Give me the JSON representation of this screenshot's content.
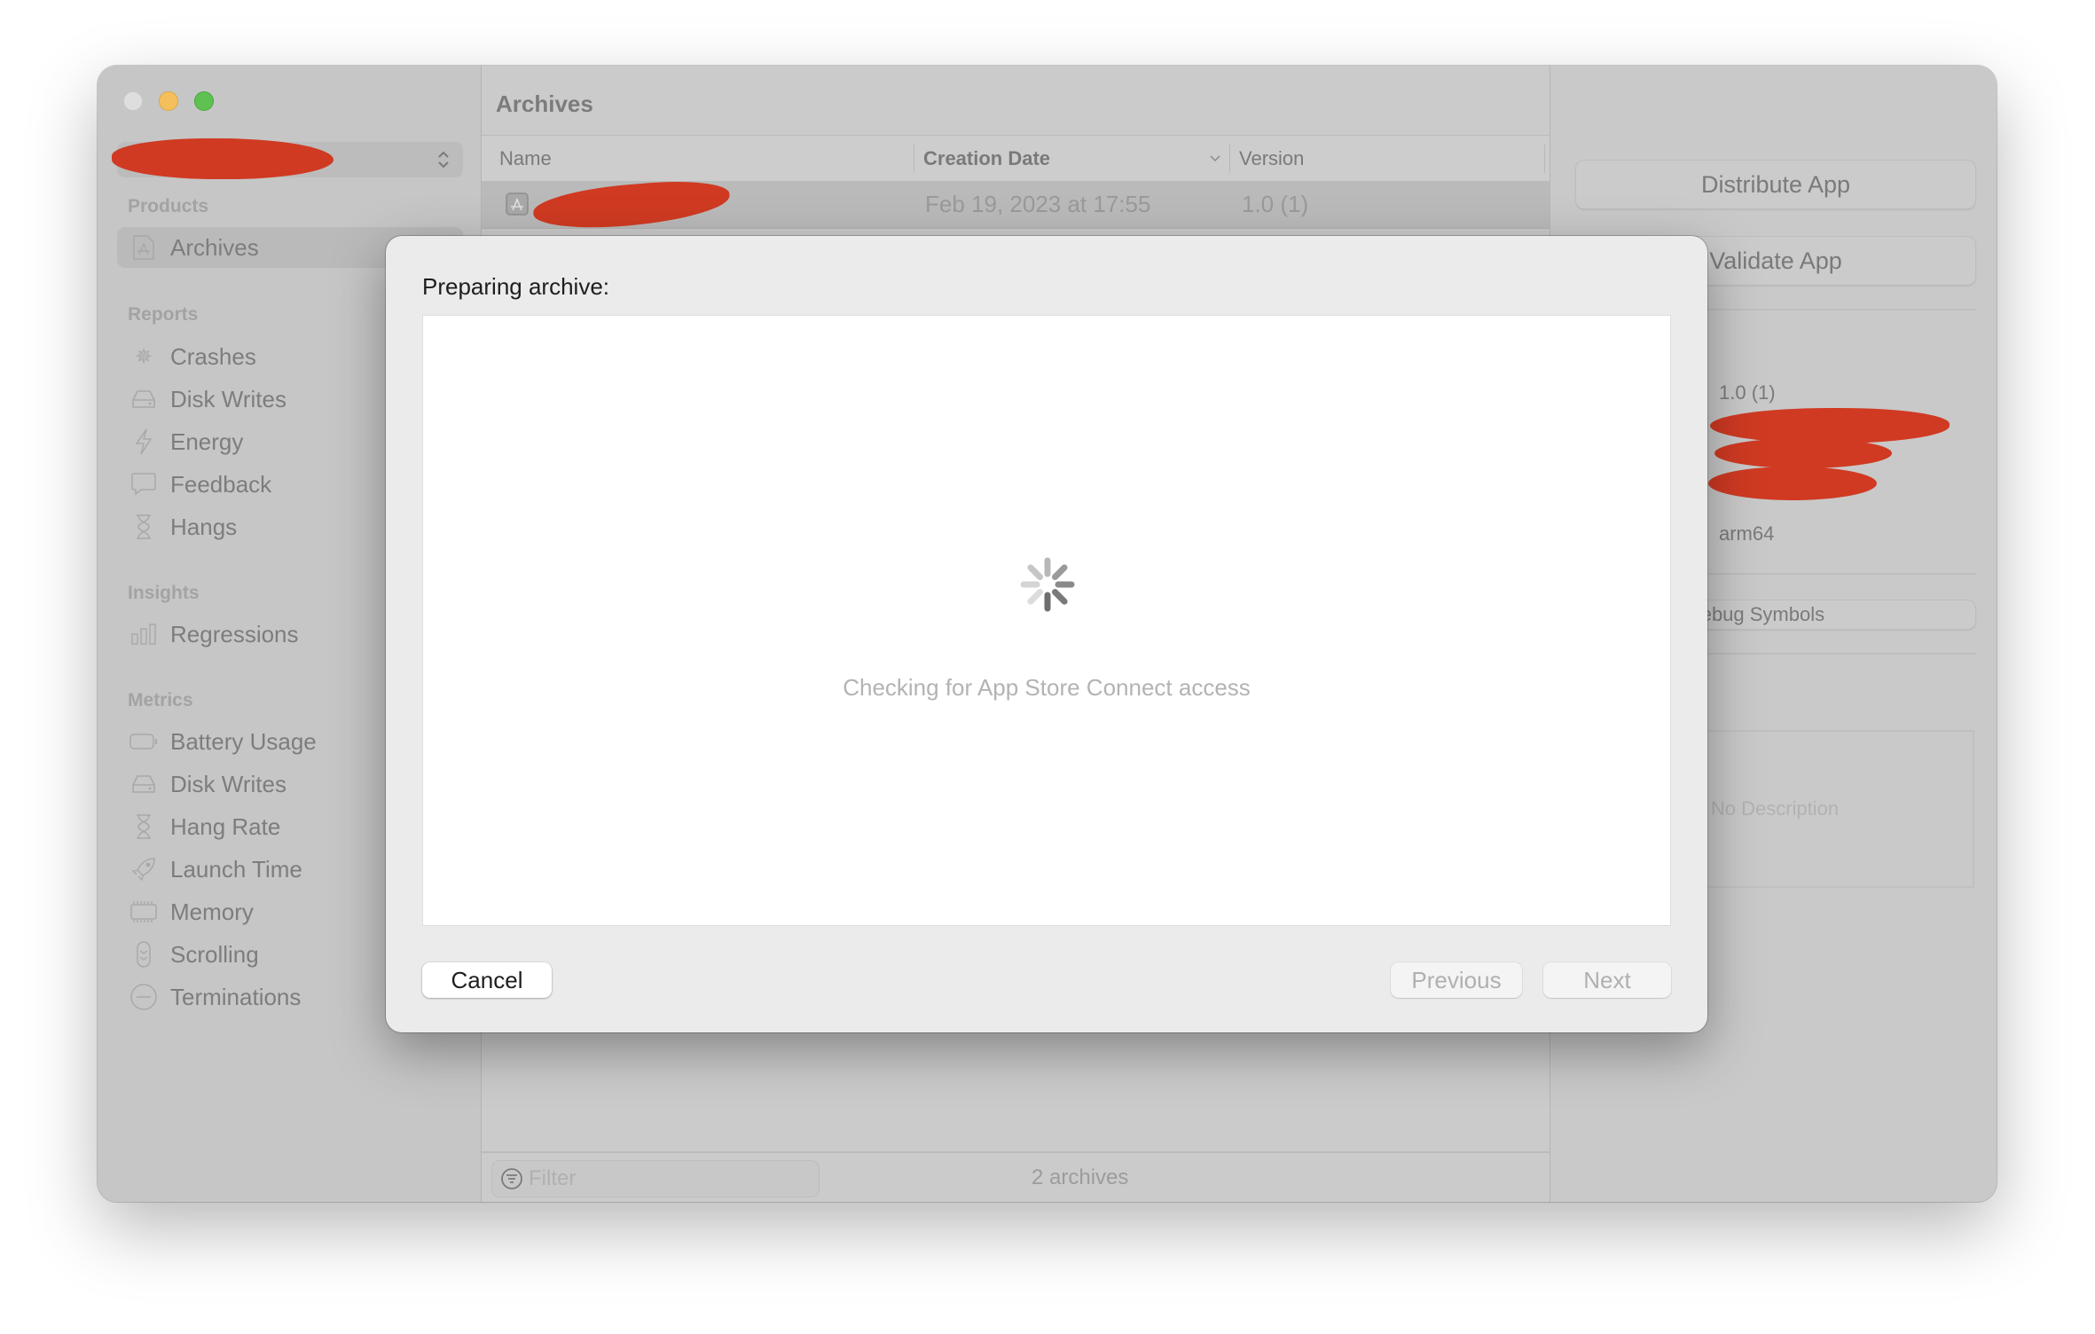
{
  "window": {
    "traffic_lights": {
      "close": "#dedede",
      "minimize": "#f5c05b",
      "zoom": "#5fc152"
    }
  },
  "sidebar": {
    "scheme_selector": {
      "value": "[redacted]",
      "chevron_icon": "up-down-chevron-icon"
    },
    "sections": [
      {
        "title": "Products",
        "items": [
          {
            "label": "Archives",
            "icon": "archive-app-icon",
            "selected": true
          }
        ]
      },
      {
        "title": "Reports",
        "items": [
          {
            "label": "Crashes",
            "icon": "crash-burst-icon"
          },
          {
            "label": "Disk Writes",
            "icon": "disk-drive-icon"
          },
          {
            "label": "Energy",
            "icon": "bolt-icon"
          },
          {
            "label": "Feedback",
            "icon": "speech-bubble-icon"
          },
          {
            "label": "Hangs",
            "icon": "hourglass-icon"
          }
        ]
      },
      {
        "title": "Insights",
        "items": [
          {
            "label": "Regressions",
            "icon": "bar-chart-icon"
          }
        ]
      },
      {
        "title": "Metrics",
        "items": [
          {
            "label": "Battery Usage",
            "icon": "battery-icon"
          },
          {
            "label": "Disk Writes",
            "icon": "disk-drive-icon"
          },
          {
            "label": "Hang Rate",
            "icon": "hourglass-icon"
          },
          {
            "label": "Launch Time",
            "icon": "rocket-icon"
          },
          {
            "label": "Memory",
            "icon": "memory-chip-icon"
          },
          {
            "label": "Scrolling",
            "icon": "scroll-icon"
          },
          {
            "label": "Terminations",
            "icon": "minus-circle-icon"
          }
        ]
      }
    ]
  },
  "archives": {
    "title": "Archives",
    "columns": [
      "Name",
      "Creation Date",
      "Version"
    ],
    "sort_column": "Creation Date",
    "rows": [
      {
        "name": "[redacted]",
        "creation_date": "Feb 19, 2023 at 17:55",
        "version": "1.0 (1)"
      }
    ],
    "filter_placeholder": "Filter",
    "count_label": "2 archives"
  },
  "inspector": {
    "distribute_button": "Distribute App",
    "validate_button": "Validate App",
    "version_value": "1.0 (1)",
    "architecture_value": "arm64",
    "debug_symbols_button": "Download Debug Symbols",
    "debug_symbols_visible": "oad Debug Symbols",
    "description_placeholder": "No Description"
  },
  "modal": {
    "title": "Preparing archive:",
    "status": "Checking for App Store Connect access",
    "cancel_label": "Cancel",
    "previous_label": "Previous",
    "next_label": "Next",
    "previous_enabled": false,
    "next_enabled": false
  }
}
